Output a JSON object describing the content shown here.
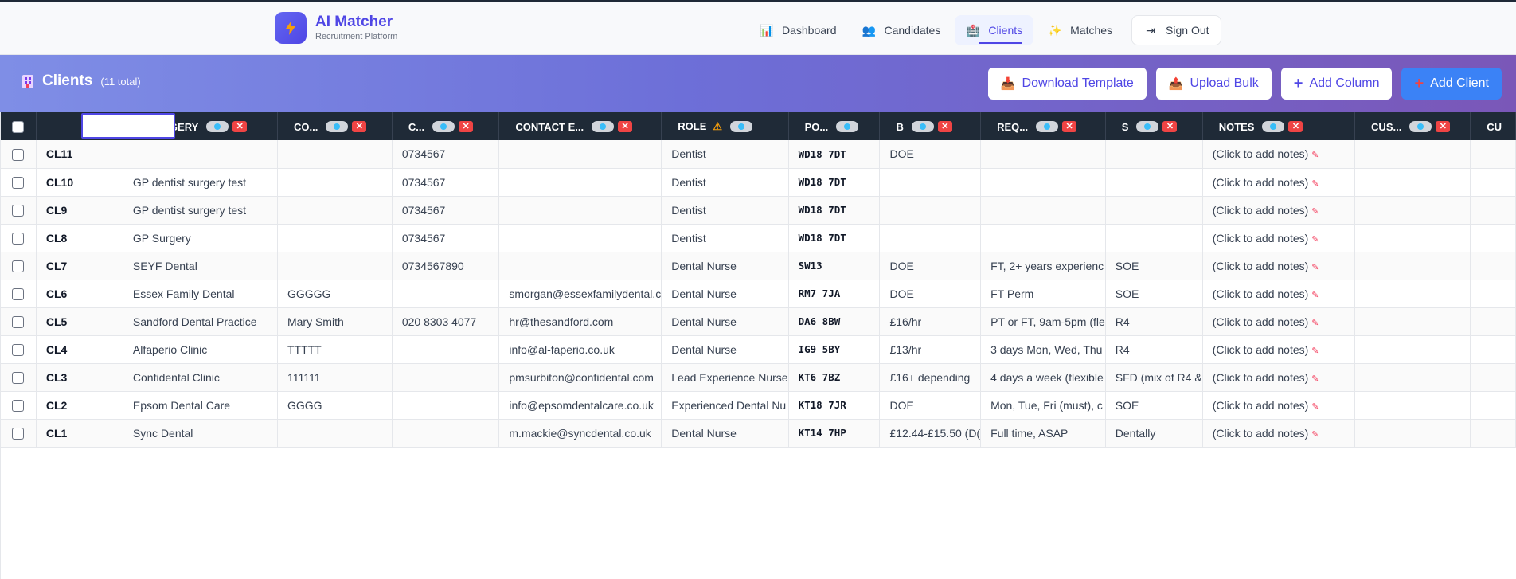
{
  "brand": {
    "title": "AI Matcher",
    "subtitle": "Recruitment Platform"
  },
  "nav": [
    {
      "label": "Dashboard",
      "icon": "chart-icon",
      "glyph": "📊",
      "active": false
    },
    {
      "label": "Candidates",
      "icon": "people-icon",
      "glyph": "👥",
      "active": false
    },
    {
      "label": "Clients",
      "icon": "building-icon",
      "glyph": "🏥",
      "active": true
    },
    {
      "label": "Matches",
      "icon": "sparkles-icon",
      "glyph": "✨",
      "active": false
    },
    {
      "label": "Sign Out",
      "icon": "sign-out-icon",
      "glyph": "⇥",
      "active": false
    }
  ],
  "header": {
    "title": "Clients",
    "count": "(11 total)",
    "actions": {
      "download_template": "Download Template",
      "upload_bulk": "Upload Bulk",
      "add_column": "Add Column",
      "add_client": "Add Client"
    }
  },
  "table": {
    "columns": [
      {
        "label": "",
        "toggle": false,
        "remove": false
      },
      {
        "label": "GERY",
        "toggle": true,
        "remove": true
      },
      {
        "label": "CO...",
        "toggle": true,
        "remove": true
      },
      {
        "label": "C...",
        "toggle": true,
        "remove": true
      },
      {
        "label": "CONTACT E...",
        "toggle": true,
        "remove": true
      },
      {
        "label": "ROLE",
        "toggle": true,
        "remove": false,
        "warning": true
      },
      {
        "label": "PO...",
        "toggle": true,
        "remove": false
      },
      {
        "label": "B",
        "toggle": true,
        "remove": true
      },
      {
        "label": "REQ...",
        "toggle": true,
        "remove": true
      },
      {
        "label": "S",
        "toggle": true,
        "remove": true
      },
      {
        "label": "NOTES",
        "toggle": true,
        "remove": true
      },
      {
        "label": "CUS...",
        "toggle": true,
        "remove": true
      },
      {
        "label": "CU",
        "toggle": false,
        "remove": false
      }
    ],
    "notes_placeholder": "(Click to add notes)",
    "rows": [
      {
        "id": "CL11",
        "surgery": "",
        "contact": "",
        "phone": "0734567",
        "email": "",
        "role": "Dentist",
        "postcode": "WD18 7DT",
        "budget": "DOE",
        "req": "",
        "system": ""
      },
      {
        "id": "CL10",
        "surgery": "GP dentist surgery test",
        "contact": "",
        "phone": "0734567",
        "email": "",
        "role": "Dentist",
        "postcode": "WD18 7DT",
        "budget": "",
        "req": "",
        "system": ""
      },
      {
        "id": "CL9",
        "surgery": "GP dentist surgery test",
        "contact": "",
        "phone": "0734567",
        "email": "",
        "role": "Dentist",
        "postcode": "WD18 7DT",
        "budget": "",
        "req": "",
        "system": ""
      },
      {
        "id": "CL8",
        "surgery": "GP Surgery",
        "contact": "",
        "phone": "0734567",
        "email": "",
        "role": "Dentist",
        "postcode": "WD18 7DT",
        "budget": "",
        "req": "",
        "system": ""
      },
      {
        "id": "CL7",
        "surgery": "SEYF Dental",
        "contact": "",
        "phone": "0734567890",
        "email": "",
        "role": "Dental Nurse",
        "postcode": "SW13",
        "budget": "DOE",
        "req": "FT, 2+ years experienc",
        "system": "SOE"
      },
      {
        "id": "CL6",
        "surgery": "Essex Family Dental",
        "contact": "GGGGG",
        "phone": "",
        "email": "smorgan@essexfamilydental.c",
        "role": "Dental Nurse",
        "postcode": "RM7 7JA",
        "budget": "DOE",
        "req": "FT Perm",
        "system": "SOE"
      },
      {
        "id": "CL5",
        "surgery": "Sandford Dental Practice",
        "contact": "Mary Smith",
        "phone": "020 8303 4077",
        "email": "hr@thesandford.com",
        "role": "Dental Nurse",
        "postcode": "DA6 8BW",
        "budget": "£16/hr",
        "req": "PT or FT, 9am-5pm (fle",
        "system": "R4"
      },
      {
        "id": "CL4",
        "surgery": "Alfaperio Clinic",
        "contact": "TTTTT",
        "phone": "",
        "email": "info@al-faperio.co.uk",
        "role": "Dental Nurse",
        "postcode": "IG9 5BY",
        "budget": "£13/hr",
        "req": "3 days Mon, Wed, Thu",
        "system": "R4"
      },
      {
        "id": "CL3",
        "surgery": "Confidental Clinic",
        "contact": "111111",
        "phone": "",
        "email": "pmsurbiton@confidental.com",
        "role": "Lead Experience Nurse",
        "postcode": "KT6 7BZ",
        "budget": "£16+ depending",
        "req": "4 days a week (flexible",
        "system": "SFD (mix of R4 &"
      },
      {
        "id": "CL2",
        "surgery": "Epsom Dental Care",
        "contact": "GGGG",
        "phone": "",
        "email": "info@epsomdentalcare.co.uk",
        "role": "Experienced Dental Nu",
        "postcode": "KT18 7JR",
        "budget": "DOE",
        "req": "Mon, Tue, Fri (must), c",
        "system": "SOE"
      },
      {
        "id": "CL1",
        "surgery": "Sync Dental",
        "contact": "",
        "phone": "",
        "email": "m.mackie@syncdental.co.uk",
        "role": "Dental Nurse",
        "postcode": "KT14 7HP",
        "budget": "£12.44-£15.50 (D(",
        "req": "Full time, ASAP",
        "system": "Dentally"
      }
    ]
  }
}
